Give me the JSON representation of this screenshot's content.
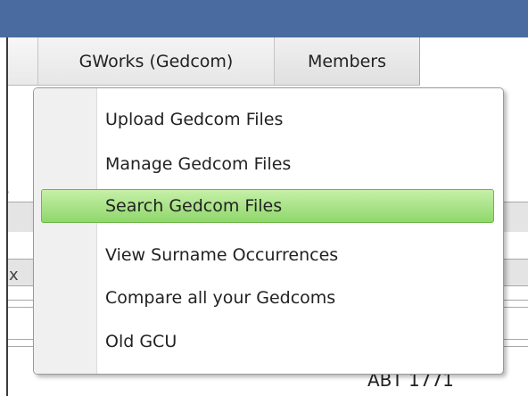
{
  "nav": {
    "tabs": [
      {
        "label": "GWorks (Gedcom)"
      },
      {
        "label": "Members"
      }
    ]
  },
  "dropdown": {
    "items": [
      {
        "label": "Upload Gedcom Files"
      },
      {
        "label": "Manage Gedcom Files"
      },
      {
        "label": "Search Gedcom Files",
        "active": true
      },
      {
        "label": "View Surname Occurrences"
      },
      {
        "label": "Compare all your Gedcoms"
      },
      {
        "label": "Old GCU"
      }
    ]
  },
  "background": {
    "column_fragment": "x",
    "date_value": "ABT 1771"
  },
  "colors": {
    "header_blue": "#4a6b9f",
    "highlight_green": "#8fd76b"
  }
}
